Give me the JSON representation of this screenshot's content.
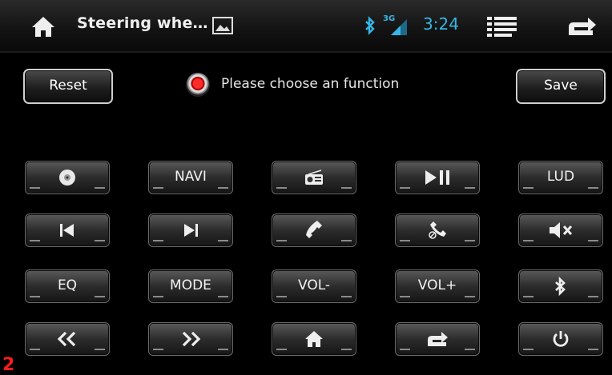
{
  "statusbar": {
    "title": "Steering whe…",
    "network": "3G",
    "time": "3:24",
    "icons": [
      "home-icon",
      "image-icon",
      "bluetooth-icon",
      "signal-icon",
      "menu-icon",
      "back-icon"
    ],
    "time_color": "#37b6e6"
  },
  "controls": {
    "reset_label": "Reset",
    "save_label": "Save",
    "status_text": "Please choose an function",
    "status_indicator_color": "#ff2a2a"
  },
  "keys": {
    "row1": [
      {
        "icon": "disc-icon"
      },
      {
        "label": "NAVI"
      },
      {
        "icon": "radio-icon"
      },
      {
        "icon": "play-pause-icon"
      },
      {
        "label": "LUD"
      }
    ],
    "row2": [
      {
        "icon": "previous-track-icon"
      },
      {
        "icon": "next-track-icon"
      },
      {
        "icon": "phone-answer-icon"
      },
      {
        "icon": "phone-hangup-icon"
      },
      {
        "icon": "mute-icon"
      }
    ],
    "row3": [
      {
        "label": "EQ"
      },
      {
        "label": "MODE"
      },
      {
        "label": "VOL-"
      },
      {
        "label": "VOL+"
      },
      {
        "icon": "bluetooth-icon"
      }
    ],
    "row4": [
      {
        "icon": "fast-rewind-icon"
      },
      {
        "icon": "fast-forward-icon"
      },
      {
        "icon": "home-icon"
      },
      {
        "icon": "back-icon"
      },
      {
        "icon": "power-icon"
      }
    ]
  },
  "page_marker": "2"
}
